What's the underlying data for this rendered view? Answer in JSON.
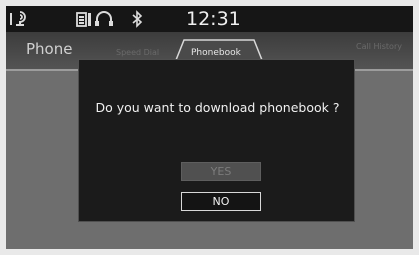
{
  "status_bar": {
    "time": "12:31",
    "icons": [
      "signal-icon",
      "phone-battery-icon",
      "headset-icon",
      "bluetooth-icon"
    ]
  },
  "header": {
    "title": "Phone",
    "tabs": [
      {
        "label": "Speed Dial",
        "active": false
      },
      {
        "label": "Phonebook",
        "active": true
      },
      {
        "label": "Call History",
        "active": false
      }
    ]
  },
  "dialog": {
    "message": "Do you want to download phonebook ?",
    "yes_label": "YES",
    "no_label": "NO",
    "yes_enabled": false
  },
  "colors": {
    "status_bar_bg": "#161616",
    "dialog_bg": "#1b1b1b",
    "screen_bg": "#6c6c6c",
    "active_tab_text": "#e6e6e6"
  }
}
